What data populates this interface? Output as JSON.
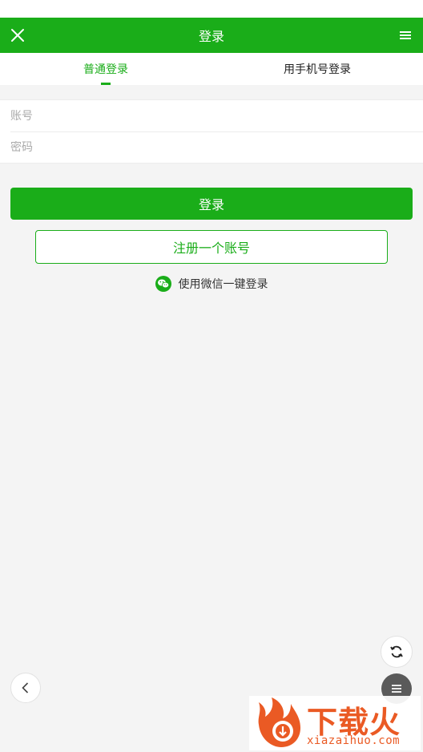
{
  "header": {
    "title": "登录"
  },
  "tabs": [
    {
      "label": "普通登录",
      "active": true
    },
    {
      "label": "用手机号登录",
      "active": false
    }
  ],
  "form": {
    "account_placeholder": "账号",
    "password_placeholder": "密码"
  },
  "actions": {
    "login_label": "登录",
    "register_label": "注册一个账号",
    "wechat_label": "使用微信一键登录"
  },
  "watermark": {
    "text_cn": "下载火",
    "text_en": "xiazaihuo.com"
  },
  "colors": {
    "brand": "#1aad19",
    "watermark": "#ea5a24",
    "background": "#f4f4f4"
  },
  "icons": [
    "close-icon",
    "menu-icon",
    "wechat-icon",
    "refresh-icon",
    "back-arrow-icon",
    "hamburger-icon",
    "watermark-logo-icon"
  ]
}
